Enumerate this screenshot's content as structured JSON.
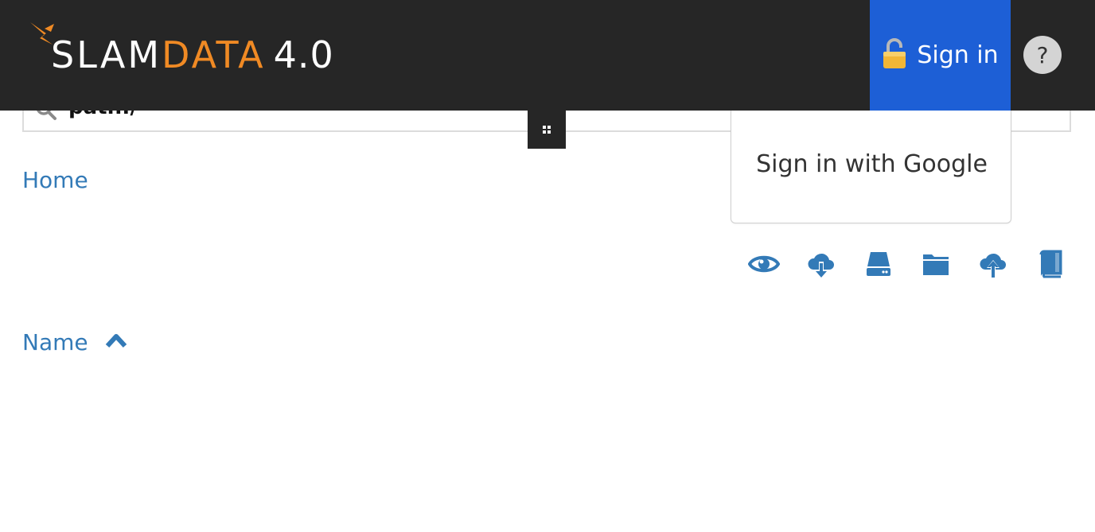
{
  "header": {
    "logo": {
      "part1": "SLAM",
      "part2": "DATA",
      "version": "4.0"
    },
    "signin_label": "Sign in",
    "help_label": "?"
  },
  "search": {
    "value": "path:/"
  },
  "signin_menu": {
    "google_label": "Sign in with Google"
  },
  "breadcrumb": {
    "home_label": "Home"
  },
  "toolbar": {
    "icons": [
      "eye-icon",
      "cloud-download-icon",
      "hard-drive-icon",
      "folder-icon",
      "cloud-upload-icon",
      "book-icon"
    ]
  },
  "table": {
    "sort_column_label": "Name",
    "sort_direction": "ascending"
  },
  "colors": {
    "header_bg": "#262626",
    "brand_orange": "#f08a24",
    "signin_blue": "#1d5fd6",
    "link_blue": "#337ab7"
  }
}
